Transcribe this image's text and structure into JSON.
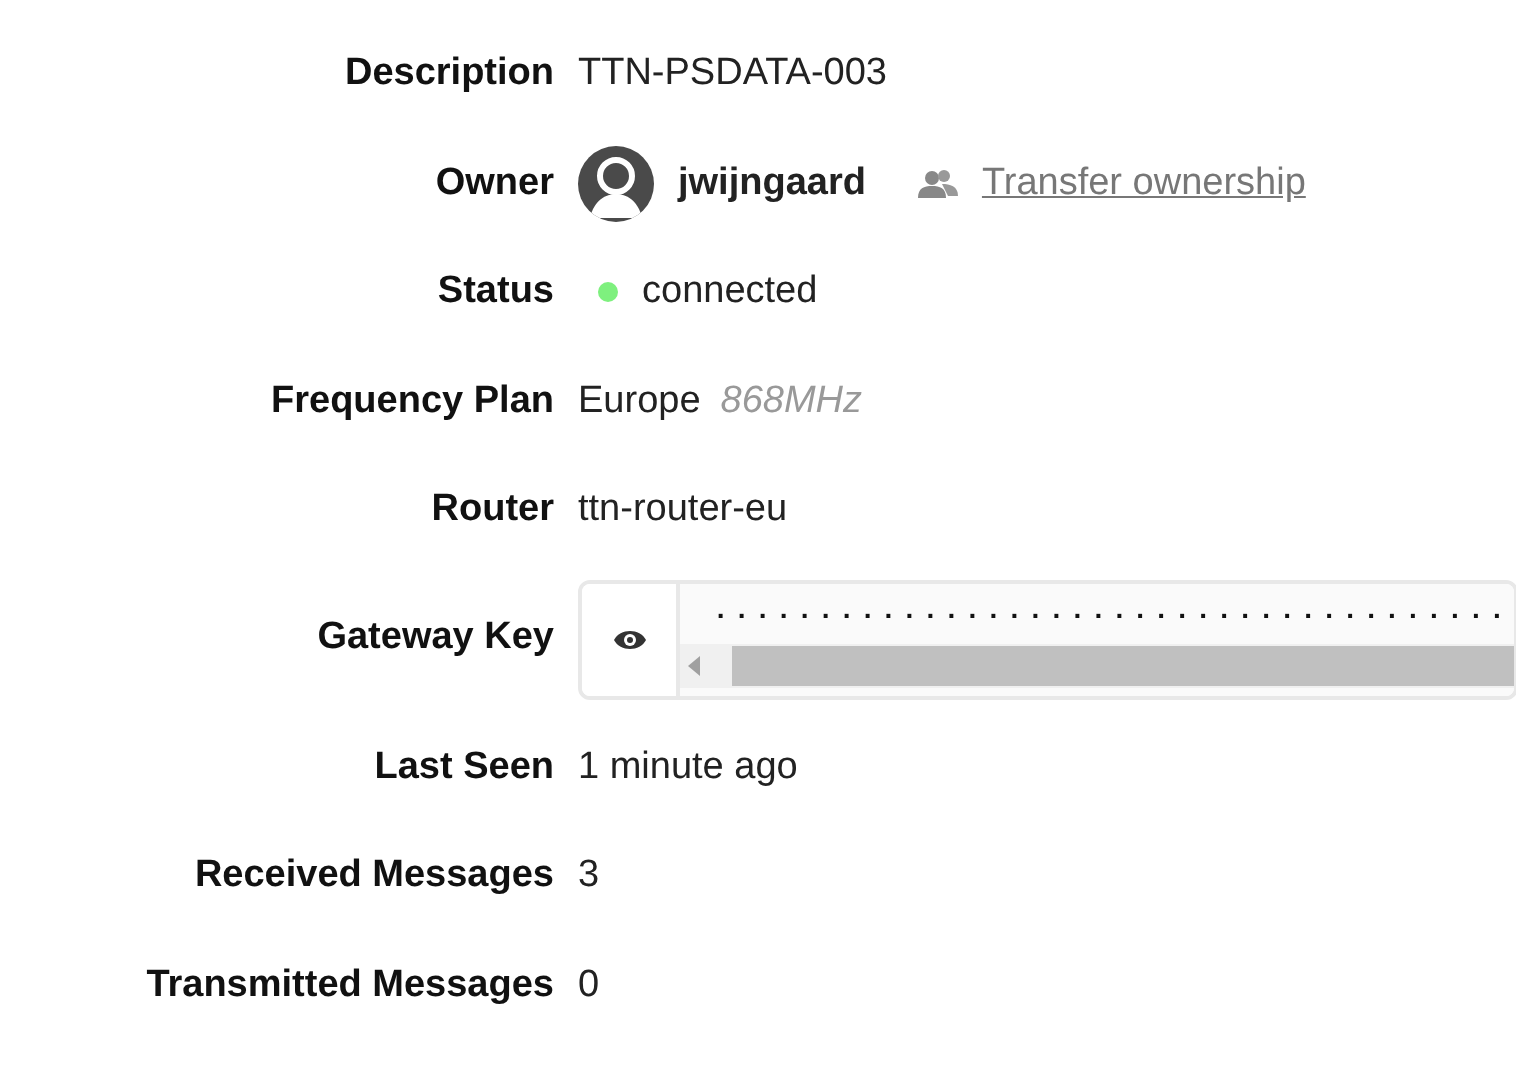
{
  "fields": [
    {
      "kind": "text",
      "label": "Description",
      "value": "TTN-PSDATA-003"
    },
    {
      "kind": "owner",
      "label": "Owner",
      "value": "jwijngaard",
      "link": "Transfer ownership"
    },
    {
      "kind": "status",
      "label": "Status",
      "value": "connected",
      "color": "#7ef07e"
    },
    {
      "kind": "frequency",
      "label": "Frequency Plan",
      "value": "Europe",
      "detail": "868MHz"
    },
    {
      "kind": "text",
      "label": "Router",
      "value": "ttn-router-eu"
    },
    {
      "kind": "secret",
      "label": "Gateway Key",
      "value": "......................................"
    },
    {
      "kind": "text",
      "label": "Last Seen",
      "value": "1 minute ago"
    },
    {
      "kind": "text",
      "label": "Received Messages",
      "value": "3"
    },
    {
      "kind": "text",
      "label": "Transmitted Messages",
      "value": "0"
    }
  ]
}
